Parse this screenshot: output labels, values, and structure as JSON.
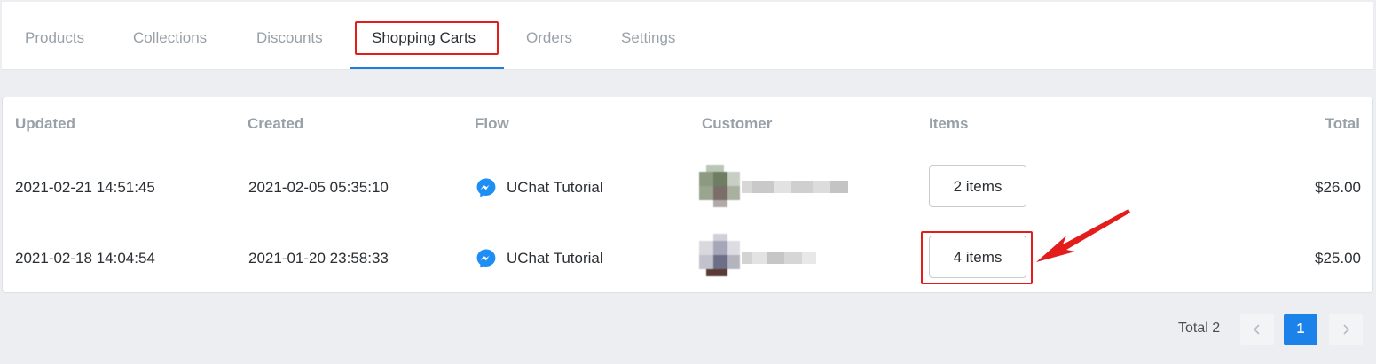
{
  "tabs": [
    {
      "label": "Products",
      "active": false
    },
    {
      "label": "Collections",
      "active": false
    },
    {
      "label": "Discounts",
      "active": false
    },
    {
      "label": "Shopping Carts",
      "active": true
    },
    {
      "label": "Orders",
      "active": false
    },
    {
      "label": "Settings",
      "active": false
    }
  ],
  "table": {
    "columns": [
      "Updated",
      "Created",
      "Flow",
      "Customer",
      "Items",
      "Total"
    ],
    "rows": [
      {
        "updated": "2021-02-21 14:51:45",
        "created": "2021-02-05 05:35:10",
        "flow": "UChat Tutorial",
        "flow_icon": "messenger-icon",
        "customer_avatar": "avatar-pixelated",
        "items": "2 items",
        "total": "$26.00"
      },
      {
        "updated": "2021-02-18 14:04:54",
        "created": "2021-01-20 23:58:33",
        "flow": "UChat Tutorial",
        "flow_icon": "messenger-icon",
        "customer_avatar": "avatar-pixelated",
        "items": "4 items",
        "total": "$25.00"
      }
    ]
  },
  "pagination": {
    "total_label": "Total 2",
    "current_page": "1",
    "prev_icon": "chevron-left-icon",
    "next_icon": "chevron-right-icon"
  },
  "colors": {
    "accent": "#1a82e8",
    "annotation": "#e31c1c",
    "messenger": "#1e8ef7"
  }
}
